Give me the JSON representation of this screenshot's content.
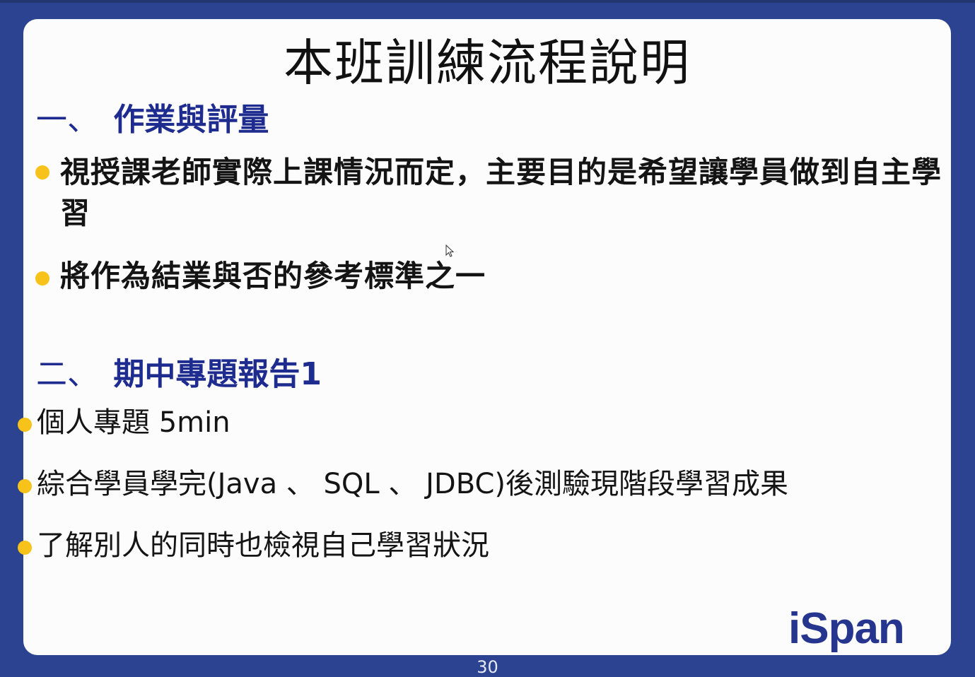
{
  "slide": {
    "title": "本班訓練流程說明",
    "section1": {
      "number": "一、",
      "heading": "作業與評量",
      "bullets": [
        "視授課老師實際上課情況而定，主要目的是希望讓學員做到自主學習",
        "將作為結業與否的參考標準之一"
      ]
    },
    "section2": {
      "number": "二、",
      "heading": "期中專題報告1",
      "bullets": [
        "個人專題 5min",
        "綜合學員學完(Java 、 SQL 、 JDBC)後測驗現階段學習成果",
        "了解別人的同時也檢視自己學習狀況"
      ]
    },
    "logo_text": "iSpan",
    "page_number": "30"
  },
  "colors": {
    "background": "#2b4390",
    "heading": "#1f2c8f",
    "bullet_dot": "#f7c21a",
    "logo": "#26368f"
  }
}
